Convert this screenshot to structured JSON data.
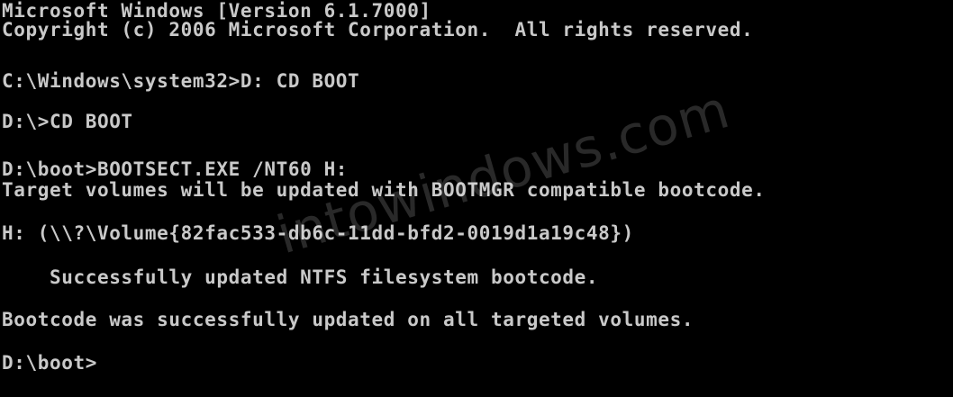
{
  "console": {
    "lines": [
      "Microsoft Windows [Version 6.1.7000]",
      "Copyright (c) 2006 Microsoft Corporation.  All rights reserved.",
      "C:\\Windows\\system32>D: CD BOOT",
      "D:\\>CD BOOT",
      "D:\\boot>BOOTSECT.EXE /NT60 H:",
      "Target volumes will be updated with BOOTMGR compatible bootcode.",
      "H: (\\\\?\\Volume{82fac533-db6c-11dd-bfd2-0019d1a19c48})",
      "    Successfully updated NTFS filesystem bootcode.",
      "Bootcode was successfully updated on all targeted volumes.",
      "D:\\boot>"
    ],
    "text_color": "#c9c9c9",
    "background_color": "#000000"
  },
  "watermark": {
    "text": "intowindows.com"
  }
}
